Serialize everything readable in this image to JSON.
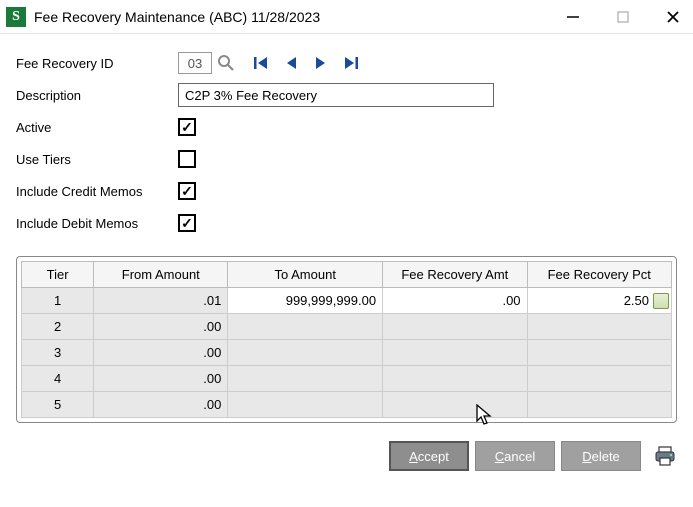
{
  "window": {
    "title": "Fee Recovery Maintenance (ABC) 11/28/2023"
  },
  "form": {
    "id_label": "Fee Recovery ID",
    "id_value": "03",
    "desc_label": "Description",
    "desc_value": "C2P 3% Fee Recovery",
    "active_label": "Active",
    "active_checked": true,
    "use_tiers_label": "Use Tiers",
    "use_tiers_checked": false,
    "include_credit_label": "Include Credit Memos",
    "include_credit_checked": true,
    "include_debit_label": "Include Debit Memos",
    "include_debit_checked": true
  },
  "grid": {
    "headers": {
      "tier": "Tier",
      "from": "From Amount",
      "to": "To Amount",
      "amt": "Fee Recovery Amt",
      "pct": "Fee Recovery Pct"
    },
    "rows": [
      {
        "tier": "1",
        "from": ".01",
        "to": "999,999,999.00",
        "amt": ".00",
        "pct": "2.50",
        "active": true
      },
      {
        "tier": "2",
        "from": ".00",
        "to": "",
        "amt": "",
        "pct": "",
        "active": false
      },
      {
        "tier": "3",
        "from": ".00",
        "to": "",
        "amt": "",
        "pct": "",
        "active": false
      },
      {
        "tier": "4",
        "from": ".00",
        "to": "",
        "amt": "",
        "pct": "",
        "active": false
      },
      {
        "tier": "5",
        "from": ".00",
        "to": "",
        "amt": "",
        "pct": "",
        "active": false
      }
    ]
  },
  "buttons": {
    "accept": "Accept",
    "cancel": "Cancel",
    "delete": "Delete"
  }
}
